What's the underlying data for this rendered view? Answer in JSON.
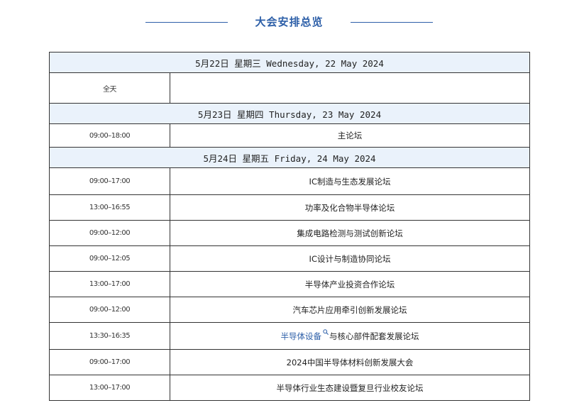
{
  "heading": "大会安排总览",
  "days": {
    "d1": {
      "header": "5月22日 星期三 Wednesday, 22 May 2024",
      "rows": [
        {
          "time": "全天",
          "event": ""
        }
      ]
    },
    "d2": {
      "header": "5月23日 星期四 Thursday, 23 May 2024",
      "rows": [
        {
          "time": "09:00–18:00",
          "event": "主论坛"
        }
      ]
    },
    "d3": {
      "header": "5月24日 星期五 Friday, 24 May 2024",
      "rows": [
        {
          "time": "09:00–17:00",
          "event": "IC制造与生态发展论坛"
        },
        {
          "time": "13:00–16:55",
          "event": "功率及化合物半导体论坛"
        },
        {
          "time": "09:00–12:00",
          "event": "集成电路检测与测试创新论坛"
        },
        {
          "time": "09:00–12:05",
          "event": "IC设计与制造协同论坛"
        },
        {
          "time": "13:00–17:00",
          "event": "半导体产业投资合作论坛"
        },
        {
          "time": "09:00–12:00",
          "event": "汽车芯片应用牵引创新发展论坛"
        },
        {
          "time": "13:30–16:35",
          "event_link": "半导体设备",
          "event_rest": "与核心部件配套发展论坛"
        },
        {
          "time": "09:00–17:00",
          "event": "2024中国半导体材料创新发展大会"
        },
        {
          "time": "13:00–17:00",
          "event": "半导体行业生态建设暨复旦行业校友论坛"
        }
      ]
    }
  },
  "colors": {
    "accent": "#2d5fa8",
    "header_bg": "#eaf2fb",
    "border": "#333333"
  },
  "icons": {
    "inline_search": "search-icon"
  }
}
